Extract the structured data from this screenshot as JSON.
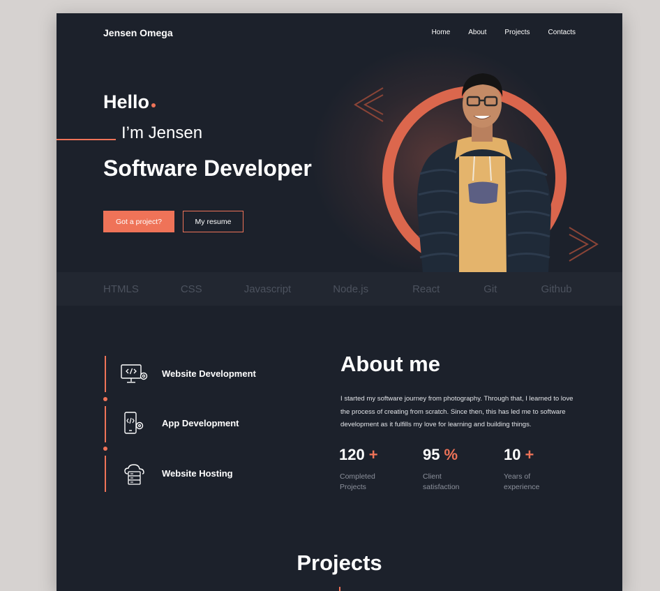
{
  "brand": {
    "logo": "Jensen Omega"
  },
  "nav": {
    "items": [
      "Home",
      "About",
      "Projects",
      "Contacts"
    ]
  },
  "hero": {
    "greeting": "Hello",
    "intro": "I’m Jensen",
    "role": "Software Developer",
    "primary_button": "Got a project?",
    "secondary_button": "My resume"
  },
  "tech": [
    "HTMLS",
    "CSS",
    "Javascript",
    "Node.js",
    "React",
    "Git",
    "Github"
  ],
  "services": [
    {
      "label": "Website Development",
      "icon": "monitor-code-icon"
    },
    {
      "label": "App Development",
      "icon": "mobile-code-icon"
    },
    {
      "label": "Website Hosting",
      "icon": "cloud-server-icon"
    }
  ],
  "about": {
    "title": "About me",
    "text": "I started my software journey from photography. Through that, I learned to love the process of creating from scratch. Since then, this has led me to software development as it fulfills my love for learning and building things.",
    "stats": [
      {
        "value": "120",
        "suffix": "+",
        "label": "Completed Projects"
      },
      {
        "value": "95",
        "suffix": "%",
        "label": "Client satisfaction"
      },
      {
        "value": "10",
        "suffix": "+",
        "label": "Years of experience"
      }
    ]
  },
  "projects": {
    "title": "Projects"
  },
  "colors": {
    "accent": "#ef7358",
    "background": "#1c212b",
    "techbar": "#222731"
  }
}
